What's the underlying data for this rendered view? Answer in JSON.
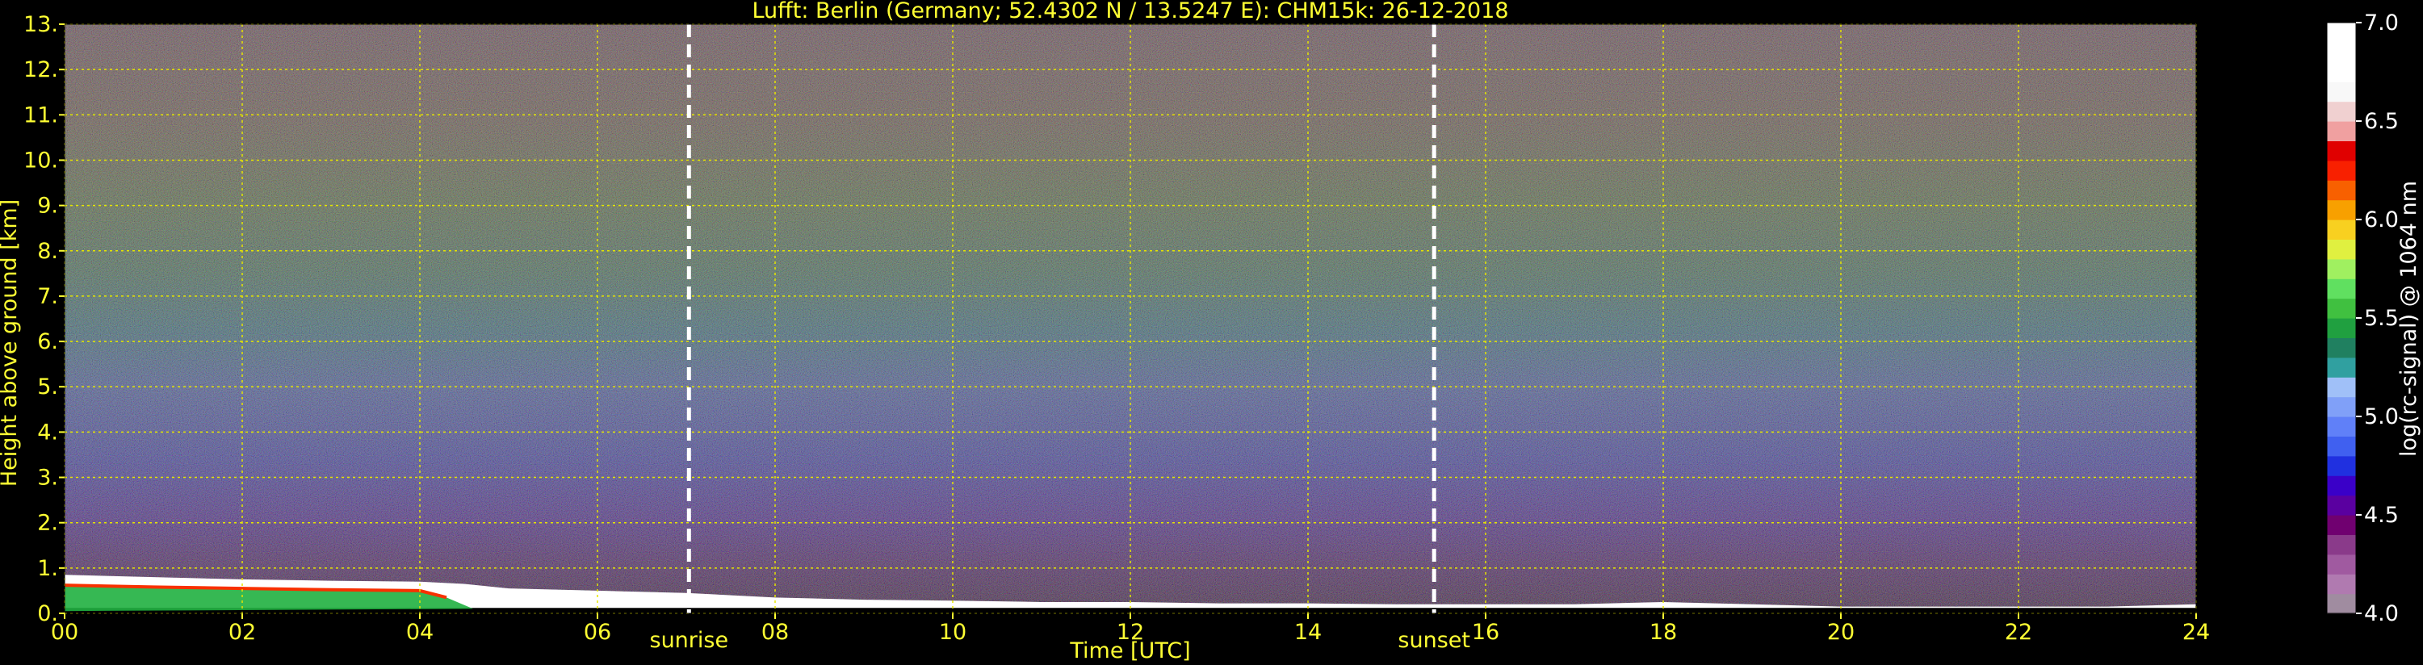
{
  "chart_data": {
    "type": "heatmap",
    "title": "Lufft: Berlin (Germany; 52.4302 N / 13.5247 E):    CHM15k: 26-12-2018",
    "xlabel": "Time [UTC]",
    "ylabel": "Height above ground [km]",
    "xlim": [
      0,
      24
    ],
    "ylim": [
      0,
      13
    ],
    "x_ticks": [
      0,
      2,
      4,
      6,
      8,
      10,
      12,
      14,
      16,
      18,
      20,
      22,
      24
    ],
    "x_tick_labels": [
      "00",
      "02",
      "04",
      "06",
      "08",
      "10",
      "12",
      "14",
      "16",
      "18",
      "20",
      "22",
      "24"
    ],
    "y_ticks": [
      0,
      1,
      2,
      3,
      4,
      5,
      6,
      7,
      8,
      9,
      10,
      11,
      12,
      13
    ],
    "y_tick_labels": [
      "0.",
      "1.",
      "2.",
      "3.",
      "4.",
      "5.",
      "6.",
      "7.",
      "8.",
      "9.",
      "10.",
      "11.",
      "12.",
      "13."
    ],
    "grid": true,
    "colorbar": {
      "label": "log(rc-signal) @ 1064 nm",
      "range": [
        4.0,
        7.0
      ],
      "ticks": [
        4.0,
        4.5,
        5.0,
        5.5,
        6.0,
        6.5,
        7.0
      ],
      "tick_labels": [
        "4.0",
        "4.5",
        "5.0",
        "5.5",
        "6.0",
        "6.5",
        "7.0"
      ],
      "colors": [
        "#a08ca0",
        "#b07ab0",
        "#a05aa0",
        "#8a3a8a",
        "#700070",
        "#5a00a0",
        "#3a00c8",
        "#2030e0",
        "#4060f0",
        "#6080f8",
        "#80a0f8",
        "#a0c0f8",
        "#30a0a0",
        "#208060",
        "#20a040",
        "#40c040",
        "#60e060",
        "#a0f060",
        "#e0f040",
        "#f8d020",
        "#f8a000",
        "#f86000",
        "#f82000",
        "#e00000",
        "#f0a0a0",
        "#f0d0d0",
        "#f8f8f8",
        "#ffffff",
        "#ffffff",
        "#ffffff"
      ]
    },
    "markers": [
      {
        "label": "sunrise",
        "x": 7.03
      },
      {
        "label": "sunset",
        "x": 15.42
      }
    ],
    "signal_profile": {
      "description_values": "approx. top height of low-level strong backscatter layer (km) vs time (h)",
      "time": [
        0,
        1,
        2,
        3,
        4,
        4.5,
        5,
        6,
        7,
        8,
        9,
        10,
        11,
        12,
        13,
        14,
        15,
        16,
        17,
        18,
        19,
        20,
        21,
        22,
        23,
        24
      ],
      "height": [
        0.85,
        0.8,
        0.75,
        0.72,
        0.7,
        0.65,
        0.55,
        0.5,
        0.45,
        0.35,
        0.3,
        0.28,
        0.25,
        0.25,
        0.22,
        0.22,
        0.2,
        0.2,
        0.2,
        0.25,
        0.2,
        0.15,
        0.15,
        0.15,
        0.15,
        0.2
      ]
    }
  }
}
